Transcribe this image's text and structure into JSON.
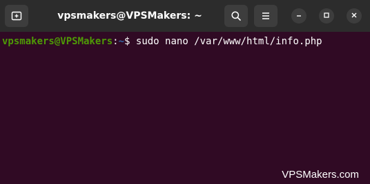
{
  "window": {
    "title": "vpsmakers@VPSMakers: ~"
  },
  "titlebar": {
    "new_tab_icon": "new-tab-icon",
    "search_icon": "search-icon",
    "menu_icon": "hamburger-menu-icon",
    "minimize_icon": "minimize-icon",
    "maximize_icon": "maximize-icon",
    "close_icon": "close-icon"
  },
  "terminal": {
    "prompt_user": "vpsmakers@VPSMakers",
    "prompt_colon": ":",
    "prompt_path": "~",
    "prompt_symbol": "$ ",
    "command": "sudo nano /var/www/html/info.php"
  },
  "watermark": "VPSMakers.com",
  "colors": {
    "terminal_bg": "#300a24",
    "titlebar_bg": "#2c2c2c",
    "prompt_user": "#4e9a06",
    "prompt_path": "#3465a4"
  }
}
